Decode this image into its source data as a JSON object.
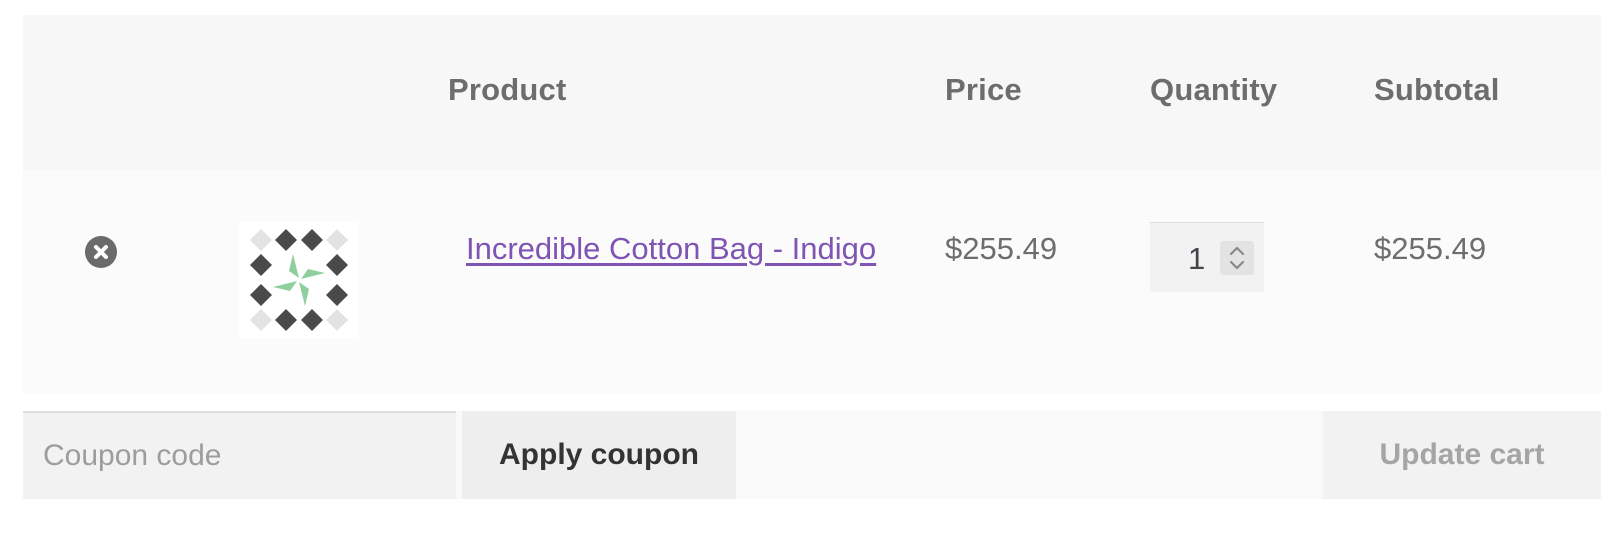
{
  "table": {
    "headers": {
      "product": "Product",
      "price": "Price",
      "quantity": "Quantity",
      "subtotal": "Subtotal"
    },
    "items": [
      {
        "name": "Incredible Cotton Bag - Indigo",
        "price": "$255.49",
        "quantity": "1",
        "subtotal": "$255.49",
        "remove_icon": "remove-circle-x-icon",
        "thumbnail_icon": "pinwheel-pattern-thumbnail"
      }
    ]
  },
  "actions": {
    "coupon_placeholder": "Coupon code",
    "coupon_value": "",
    "apply_label": "Apply coupon",
    "update_label": "Update cart"
  },
  "colors": {
    "link": "#7f54b3",
    "header_bg": "#f7f7f7",
    "row_bg": "#fbfbfb",
    "text": "#6d6d6d",
    "thumbnail_accent": "#8fcf9e",
    "thumbnail_dark": "#4a4a4a"
  }
}
